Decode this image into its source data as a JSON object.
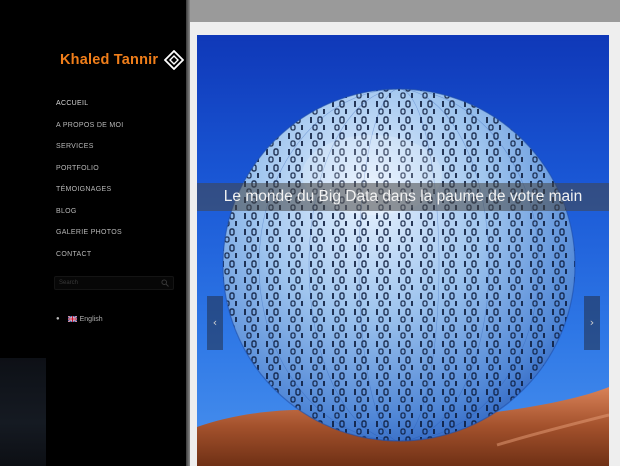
{
  "site": {
    "logo_text": "Khaled Tannir",
    "logo_icon": "diamond-logo-icon",
    "brand_color": "#f07e1a"
  },
  "nav": {
    "items": [
      {
        "label": "ACCUEIL"
      },
      {
        "label": "A PROPOS DE MOI"
      },
      {
        "label": "SERVICES"
      },
      {
        "label": "PORTFOLIO"
      },
      {
        "label": "TÉMOIGNAGES"
      },
      {
        "label": "BLOG"
      },
      {
        "label": "GALERIE PHOTOS"
      },
      {
        "label": "CONTACT"
      }
    ]
  },
  "search": {
    "placeholder": "Search",
    "icon": "search-icon"
  },
  "language": {
    "label": "English",
    "flag_icon": "uk-flag-icon"
  },
  "slider": {
    "caption": "Le monde du Big Data dans la paume de votre main",
    "prev_icon": "chevron-left-icon",
    "next_icon": "chevron-right-icon",
    "prev_glyph": "‹",
    "next_glyph": "›"
  }
}
